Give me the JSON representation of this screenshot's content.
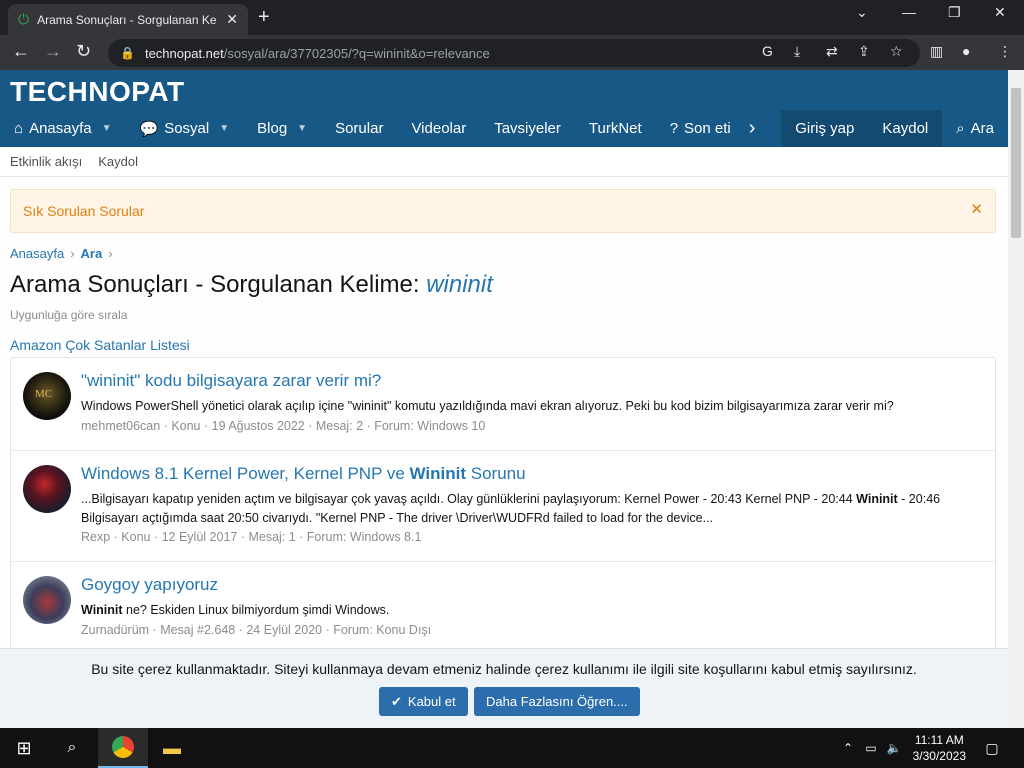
{
  "browser": {
    "tab_title": "Arama Sonuçları - Sorgulanan Ke",
    "tab_close": "✕",
    "new_tab": "+",
    "url_host": "technopat.net",
    "url_path": "/sosyal/ara/37702305/?q=wininit&o=relevance"
  },
  "site": {
    "logo": "TECHNOPAT",
    "nav": [
      {
        "label": "Anasayfa",
        "icon": "home-icon"
      },
      {
        "label": "Sosyal",
        "icon": "chat-icon"
      },
      {
        "label": "Blog"
      },
      {
        "label": "Sorular"
      },
      {
        "label": "Videolar"
      },
      {
        "label": "Tavsiyeler"
      },
      {
        "label": "TurkNet"
      },
      {
        "label": "Son eti",
        "icon": "question-icon"
      }
    ],
    "nav_right": {
      "login": "Giriş yap",
      "register": "Kaydol",
      "search": "Ara"
    },
    "subnav": [
      "Etkinlik akışı",
      "Kaydol"
    ]
  },
  "notice": {
    "text": "Sık Sorulan Sorular",
    "close": "✕"
  },
  "breadcrumb": [
    "Anasayfa",
    "Ara"
  ],
  "page": {
    "title_prefix": "Arama Sonuçları - Sorgulanan Kelime: ",
    "query": "wininit",
    "sort_hint": "Uygunluğa göre sırala",
    "amazon_link": "Amazon Çok Satanlar Listesi"
  },
  "results": [
    {
      "title": "\"wininit\" kodu bilgisayara zarar verir mi?",
      "snippet": "Windows PowerShell yönetici olarak açılıp içine \"wininit\" komutu yazıldığında mavi ekran alıyoruz. Peki bu kod bizim bilgisayarımıza zarar verir mi?",
      "meta": "mehmet06can · Konu · 19 Ağustos 2022 · Mesaj: 2 · Forum: Windows 10"
    },
    {
      "title_pre": "Windows 8.1 Kernel Power, Kernel PNP ve ",
      "title_bold": "Wininit",
      "title_post": " Sorunu",
      "snippet_pre": "...Bilgisayarı kapatıp yeniden açtım ve bilgisayar çok yavaş açıldı. Olay günlüklerini paylaşıyorum: Kernel Power - 20:43 Kernel PNP - 20:44 ",
      "snippet_bold": "Wininit",
      "snippet_post": " - 20:46 Bilgisayarı açtığımda saat 20:50 civarıydı. \"Kernel PNP - The driver \\Driver\\WUDFRd failed to load for the device...",
      "meta": "Rexp · Konu · 12 Eylül 2017 · Mesaj: 1 · Forum: Windows 8.1"
    },
    {
      "title": "Goygoy yapıyoruz",
      "snippet_bold": "Wininit",
      "snippet_post": " ne? Eskiden Linux bilmiyordum şimdi Windows.",
      "meta": "Zurnadürüm · Mesaj #2.648 · 24 Eylül 2020 · Forum: Konu Dışı"
    }
  ],
  "cookie": {
    "text": "Bu site çerez kullanmaktadır. Siteyi kullanmaya devam etmeniz halinde çerez kullanımı ile ilgili site koşullarını kabul etmiş sayılırsınız.",
    "accept": "Kabul et",
    "learn_more": "Daha Fazlasını Öğren...."
  },
  "taskbar": {
    "time": "11:11 AM",
    "date": "3/30/2023"
  },
  "colors": {
    "brand": "#185886",
    "link": "#2577b1",
    "notice": "#de7f12"
  }
}
